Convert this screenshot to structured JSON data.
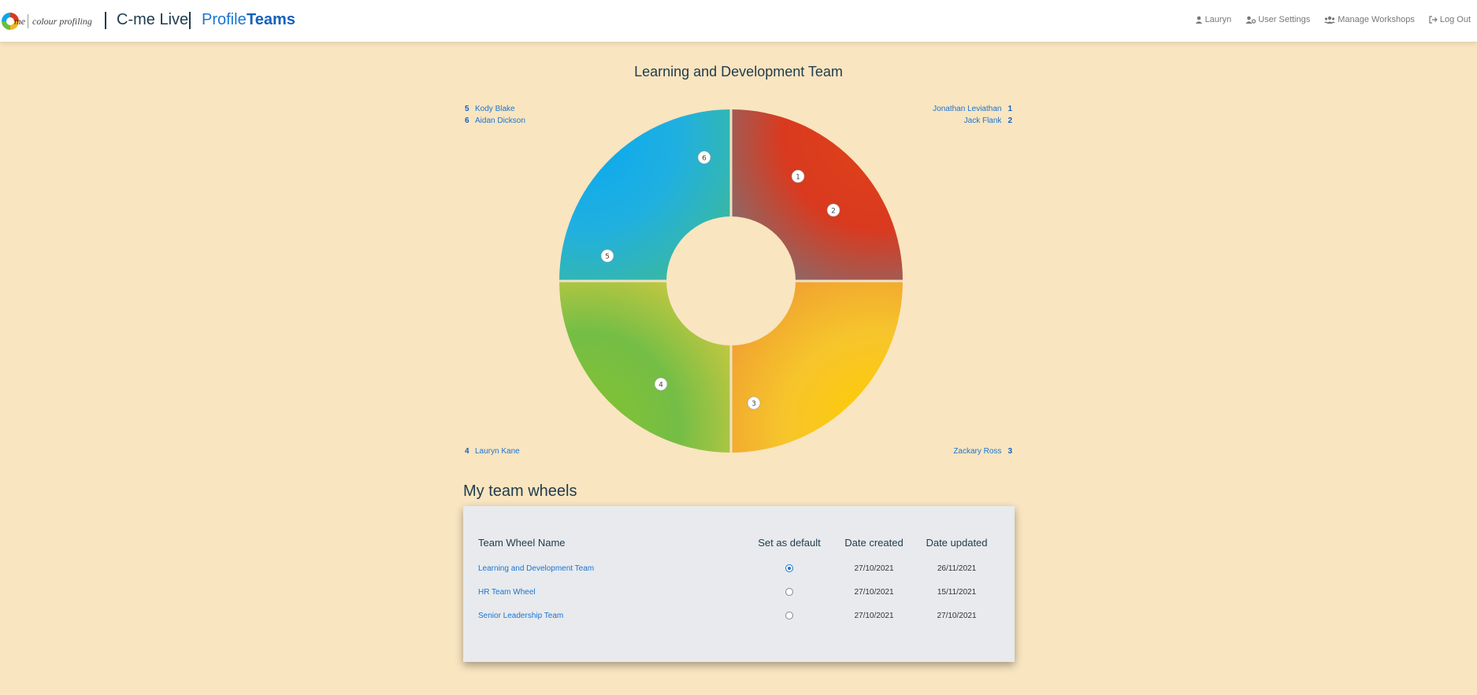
{
  "header": {
    "logo_me": "me",
    "logo_text": "colour profiling",
    "app_title": "C-me Live",
    "nav": {
      "profile": "Profile",
      "teams": "Teams"
    },
    "menu": {
      "user": "Lauryn",
      "settings": "User Settings",
      "workshops": "Manage Workshops",
      "logout": "Log Out"
    }
  },
  "wheel": {
    "title": "Learning and Development Team",
    "legend": {
      "top_left": [
        {
          "num": "5",
          "name": "Kody Blake"
        },
        {
          "num": "6",
          "name": "Aidan Dickson"
        }
      ],
      "top_right": [
        {
          "num": "1",
          "name": "Jonathan Leviathan"
        },
        {
          "num": "2",
          "name": "Jack Flank"
        }
      ],
      "bottom_left": [
        {
          "num": "4",
          "name": "Lauryn Kane"
        }
      ],
      "bottom_right": [
        {
          "num": "3",
          "name": "Zackary Ross"
        }
      ]
    },
    "markers": [
      "1",
      "2",
      "3",
      "4",
      "5",
      "6"
    ]
  },
  "team_wheels": {
    "title": "My team wheels",
    "columns": {
      "name": "Team Wheel Name",
      "default": "Set as default",
      "created": "Date created",
      "updated": "Date updated"
    },
    "rows": [
      {
        "name": "Learning and Development Team",
        "default": true,
        "created": "27/10/2021",
        "updated": "26/11/2021"
      },
      {
        "name": "HR Team Wheel",
        "default": false,
        "created": "27/10/2021",
        "updated": "15/11/2021"
      },
      {
        "name": "Senior Leadership Team",
        "default": false,
        "created": "27/10/2021",
        "updated": "27/10/2021"
      }
    ]
  }
}
